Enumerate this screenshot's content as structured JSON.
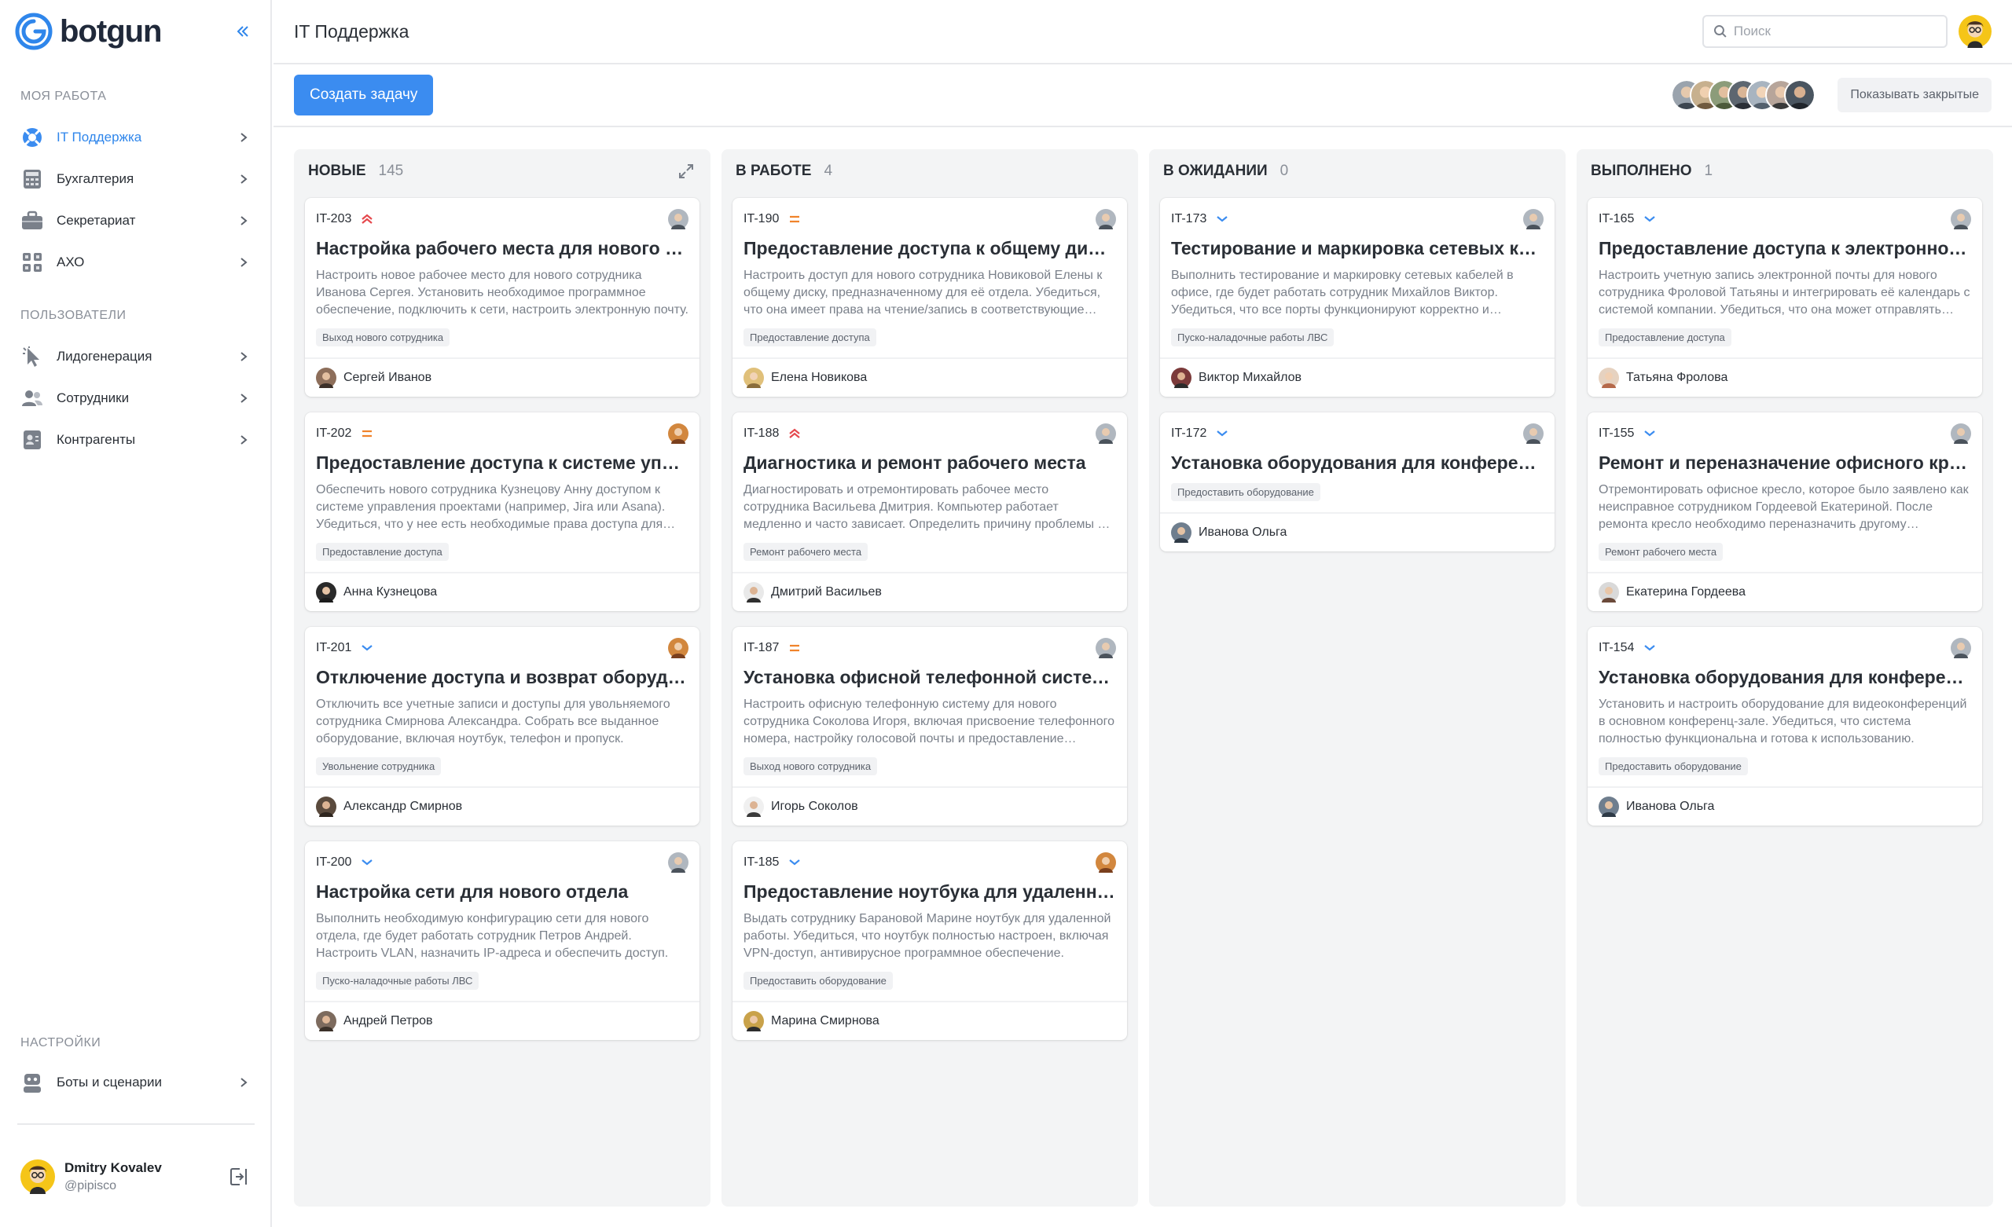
{
  "app": {
    "logo_text": "botgun"
  },
  "sidebar": {
    "section_my_work": "Моя работа",
    "section_users": "Пользователи",
    "section_settings": "Настройки",
    "items": {
      "it": "IT Поддержка",
      "accounting": "Бухгалтерия",
      "secretariat": "Секретариат",
      "axo": "АХО",
      "leadgen": "Лидогенерация",
      "employees": "Сотрудники",
      "contractors": "Контрагенты",
      "bots": "Боты и сценарии"
    },
    "user": {
      "name": "Dmitry Kovalev",
      "handle": "@pipisco"
    }
  },
  "header": {
    "title": "IT Поддержка",
    "search_placeholder": "Поиск"
  },
  "toolbar": {
    "create_label": "Создать задачу",
    "show_closed_label": "Показывать закрытые"
  },
  "colors": {
    "accent": "#3b8cf0",
    "prio_high": "#e5484d",
    "prio_medium": "#f0832b",
    "prio_low": "#3b8cf0"
  },
  "columns": [
    {
      "title": "Новые",
      "count": "145",
      "cards": [
        {
          "id": "IT-203",
          "priority": "high",
          "title": "Настройка рабочего места для нового сотрудника",
          "desc": "Настроить новое рабочее место для нового сотрудника Иванова Сергея. Установить необходимое программное обеспечение, подключить к сети, настроить электронную почту.",
          "tag": "Выход нового сотрудника",
          "assignee": "Сергей Иванов"
        },
        {
          "id": "IT-202",
          "priority": "medium",
          "title": "Предоставление доступа к системе управления проектами",
          "desc": "Обеспечить нового сотрудника Кузнецову Анну доступом к системе управления проектами (например, Jira или Asana). Убедиться, что у нее есть необходимые права доступа для работы.",
          "tag": "Предоставление доступа",
          "assignee": "Анна Кузнецова"
        },
        {
          "id": "IT-201",
          "priority": "low",
          "title": "Отключение доступа и возврат оборудования",
          "desc": "Отключить все учетные записи и доступы для увольняемого сотрудника Смирнова Александра. Собрать все выданное оборудование, включая ноутбук, телефон и пропуск.",
          "tag": "Увольнение сотрудника",
          "assignee": "Александр Смирнов"
        },
        {
          "id": "IT-200",
          "priority": "low",
          "title": "Настройка сети для нового отдела",
          "desc": "Выполнить необходимую конфигурацию сети для нового отдела, где будет работать сотрудник Петров Андрей. Настроить VLAN, назначить IP-адреса и обеспечить доступ.",
          "tag": "Пуско-наладочные работы ЛВС",
          "assignee": "Андрей Петров"
        }
      ]
    },
    {
      "title": "В работе",
      "count": "4",
      "cards": [
        {
          "id": "IT-190",
          "priority": "medium",
          "title": "Предоставление доступа к общему диску",
          "desc": "Настроить доступ для нового сотрудника Новиковой Елены к общему диску, предназначенному для её отдела. Убедиться, что она имеет права на чтение/запись в соответствующие папки.",
          "tag": "Предоставление доступа",
          "assignee": "Елена Новикова"
        },
        {
          "id": "IT-188",
          "priority": "high",
          "title": "Диагностика и ремонт рабочего места",
          "desc": "Диагностировать и отремонтировать рабочее место сотрудника Васильева Дмитрия. Компьютер работает медленно и часто зависает. Определить причину проблемы и устранить её.",
          "tag": "Ремонт рабочего места",
          "assignee": "Дмитрий Васильев"
        },
        {
          "id": "IT-187",
          "priority": "medium",
          "title": "Установка офисной телефонной системы для сотрудника",
          "desc": "Настроить офисную телефонную систему для нового сотрудника Соколова Игоря, включая присвоение телефонного номера, настройку голосовой почты и предоставление инструкций.",
          "tag": "Выход нового сотрудника",
          "assignee": "Игорь Соколов"
        },
        {
          "id": "IT-185",
          "priority": "low",
          "title": "Предоставление ноутбука для удаленной работы",
          "desc": "Выдать сотруднику Барановой Марине ноутбук для удаленной работы. Убедиться, что ноутбук полностью настроен, включая VPN-доступ, антивирусное программное обеспечение.",
          "tag": "Предоставить оборудование",
          "assignee": "Марина Смирнова"
        }
      ]
    },
    {
      "title": "В ожидании",
      "count": "0",
      "cards": [
        {
          "id": "IT-173",
          "priority": "low",
          "title": "Тестирование и маркировка сетевых кабелей в офисе",
          "desc": "Выполнить тестирование и маркировку сетевых кабелей в офисе, где будет работать сотрудник Михайлов Виктор. Убедиться, что все порты функционируют корректно и промаркированы.",
          "tag": "Пуско-наладочные работы ЛВС",
          "assignee": "Виктор Михайлов"
        },
        {
          "id": "IT-172",
          "priority": "low",
          "title": "Установка оборудования для конференц-зала",
          "desc": "",
          "tag": "Предоставить оборудование",
          "assignee": "Иванова Ольга"
        }
      ]
    },
    {
      "title": "Выполнено",
      "count": "1",
      "cards": [
        {
          "id": "IT-165",
          "priority": "low",
          "title": "Предоставление доступа к электронной почте",
          "desc": "Настроить учетную запись электронной почты для нового сотрудника Фроловой Татьяны и интегрировать её календарь с системой компании. Убедиться, что она может отправлять письма.",
          "tag": "Предоставление доступа",
          "assignee": "Татьяна Фролова"
        },
        {
          "id": "IT-155",
          "priority": "low",
          "title": "Ремонт и переназначение офисного кресла",
          "desc": "Отремонтировать офисное кресло, которое было заявлено как неисправное сотрудником Гордеевой Екатериной. После ремонта кресло необходимо переназначить другому сотруднику.",
          "tag": "Ремонт рабочего места",
          "assignee": "Екатерина Гордеева"
        },
        {
          "id": "IT-154",
          "priority": "low",
          "title": "Установка оборудования для конференц-зала",
          "desc": "Установить и настроить оборудование для видеоконференций в основном конференц-зале. Убедиться, что система полностью функциональна и готова к использованию.",
          "tag": "Предоставить оборудование",
          "assignee": "Иванова Ольга"
        }
      ]
    }
  ]
}
